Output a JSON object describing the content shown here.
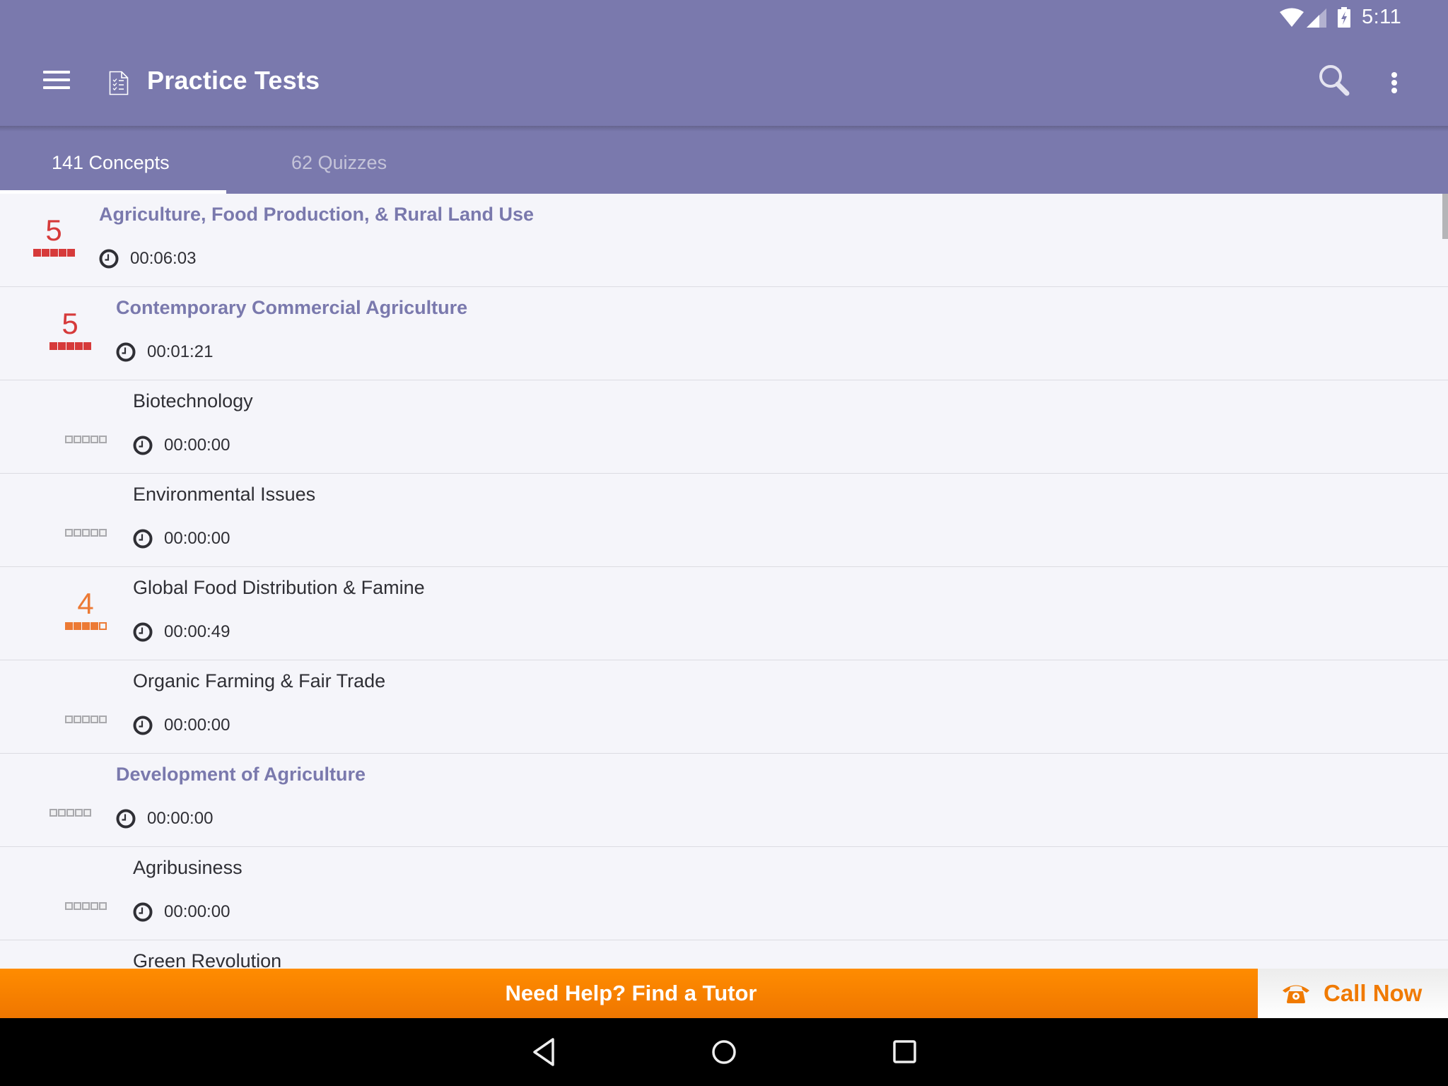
{
  "status_bar": {
    "time": "5:11",
    "icons": [
      "wifi-icon",
      "signal-icon",
      "battery-charging-icon"
    ]
  },
  "app_bar": {
    "title": "Practice Tests",
    "title_icon": "document-checklist-icon",
    "left_icon": "hamburger-menu-icon",
    "right_icons": [
      "search-icon",
      "more-vertical-icon"
    ]
  },
  "tabs": [
    {
      "label": "141 Concepts",
      "active": true
    },
    {
      "label": "62 Quizzes",
      "active": false
    }
  ],
  "colors": {
    "primary": "#7a79ad",
    "score_high": "#d63a3a",
    "score_mid": "#ec7a35",
    "banner_orange": "#f78300",
    "text_dark": "#2f2f35",
    "empty_square": "#a9a9ad"
  },
  "concepts": [
    {
      "title": "Agriculture, Food Production, & Rural Land Use",
      "level": 0,
      "type": "heading",
      "score": 5,
      "filled": 5,
      "time": "00:06:03"
    },
    {
      "title": "Contemporary Commercial Agriculture",
      "level": 1,
      "type": "heading",
      "score": 5,
      "filled": 5,
      "time": "00:01:21"
    },
    {
      "title": "Biotechnology",
      "level": 2,
      "type": "leaf",
      "score": null,
      "filled": 0,
      "time": "00:00:00"
    },
    {
      "title": "Environmental Issues",
      "level": 2,
      "type": "leaf",
      "score": null,
      "filled": 0,
      "time": "00:00:00"
    },
    {
      "title": "Global Food Distribution & Famine",
      "level": 2,
      "type": "leaf",
      "score": 4,
      "filled": 4,
      "time": "00:00:49"
    },
    {
      "title": "Organic Farming & Fair Trade",
      "level": 2,
      "type": "leaf",
      "score": null,
      "filled": 0,
      "time": "00:00:00"
    },
    {
      "title": "Development of Agriculture",
      "level": 1,
      "type": "heading",
      "score": null,
      "filled": 0,
      "time": "00:00:00"
    },
    {
      "title": "Agribusiness",
      "level": 2,
      "type": "leaf",
      "score": null,
      "filled": 0,
      "time": "00:00:00"
    },
    {
      "title": "Green Revolution",
      "level": 2,
      "type": "leaf",
      "score": null,
      "filled": 0,
      "time": null
    }
  ],
  "rating_max": 5,
  "footer": {
    "tutor_label": "Need Help? Find a Tutor",
    "call_label": "Call Now",
    "call_icon": "phone-icon"
  },
  "nav_bar": {
    "buttons": [
      "back-icon",
      "home-icon",
      "recents-icon"
    ]
  }
}
